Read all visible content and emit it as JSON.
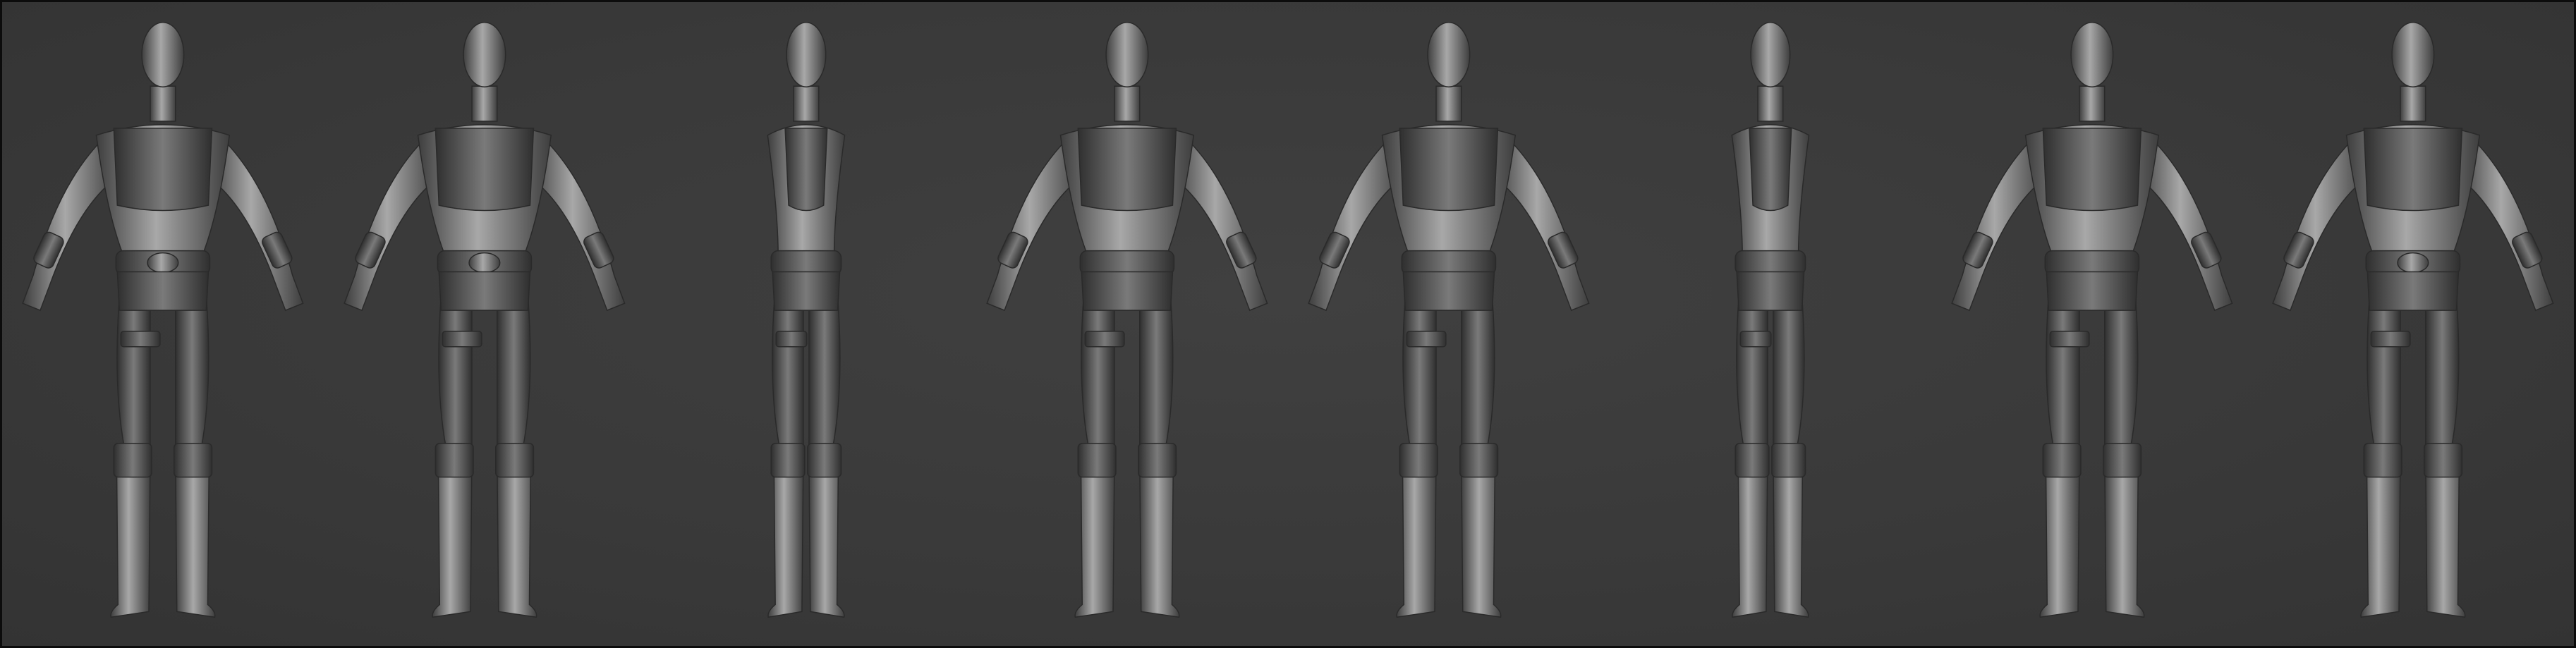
{
  "scene": {
    "background_color": "#3b3b3b",
    "border_color": "#0c0c0c",
    "material_color": "#7a7a7a",
    "material_shadow": "#3e3e3e",
    "material_highlight": "#a8a8a8",
    "subject": "sculpted-character-turnaround",
    "views": [
      {
        "id": "front",
        "facing": "front"
      },
      {
        "id": "front-three-quarter-left",
        "facing": "front-three-quarter"
      },
      {
        "id": "side-left",
        "facing": "side"
      },
      {
        "id": "back-three-quarter-left",
        "facing": "back-three-quarter"
      },
      {
        "id": "back",
        "facing": "back"
      },
      {
        "id": "side-right",
        "facing": "side"
      },
      {
        "id": "back-three-quarter-right",
        "facing": "back-three-quarter"
      },
      {
        "id": "front-three-quarter-right",
        "facing": "front-three-quarter"
      }
    ]
  }
}
